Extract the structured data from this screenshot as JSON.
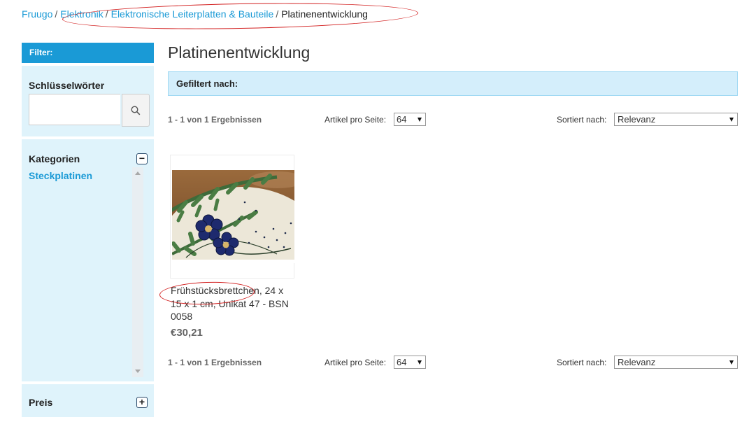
{
  "breadcrumb": {
    "items": [
      "Fruugo",
      "Elektronik",
      "Elektronische Leiterplatten & Bauteile"
    ],
    "current": "Platinenentwicklung",
    "separator": "/"
  },
  "sidebar": {
    "filter_title": "Filter:",
    "keywords": {
      "title": "Schlüsselwörter",
      "value": "",
      "placeholder": ""
    },
    "categories": {
      "title": "Kategorien",
      "toggle": "−",
      "items": [
        "Steckplatinen"
      ]
    },
    "price": {
      "title": "Preis",
      "toggle": "+"
    }
  },
  "main": {
    "title": "Platinenentwicklung",
    "filtered_by": "Gefiltert nach:",
    "results_count": "1 - 1 von 1 Ergebnissen",
    "per_page_label": "Artikel pro Seite:",
    "per_page_value": "64",
    "sort_label": "Sortiert nach:",
    "sort_value": "Relevanz"
  },
  "product": {
    "name": "Frühstücksbrettchen, 24 x 15 x 1 cm, Unikat 47 - BSN 0058",
    "price": "€30,21"
  },
  "colors": {
    "accent": "#1a9ad6",
    "panel_bg": "#dff3fb",
    "filter_bar_bg": "#d4eefb",
    "annotation": "#d21f1f"
  }
}
